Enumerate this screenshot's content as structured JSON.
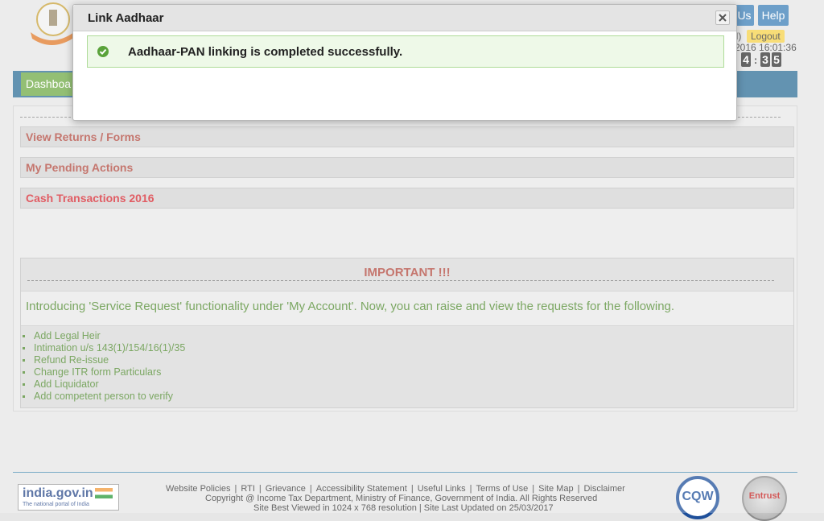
{
  "header": {
    "us_label": "Us",
    "help_label": "Help",
    "user_fragment": "il)",
    "logout_label": "Logout",
    "datetime": "2016 16:01:36",
    "timer_digits": [
      "4",
      "3",
      "5"
    ]
  },
  "nav": {
    "dashboard_label": "Dashboa"
  },
  "accordion": [
    {
      "label": "View Returns / Forms"
    },
    {
      "label": "My Pending Actions"
    },
    {
      "label": "Cash Transactions 2016"
    }
  ],
  "important": {
    "title": "IMPORTANT !!!",
    "intro": "Introducing 'Service Request' functionality under 'My Account'. Now, you can raise and view the requests for the following.",
    "items": [
      "Add Legal Heir",
      "Intimation u/s 143(1)/154/16(1)/35",
      "Refund Re-issue",
      "Change ITR form Particulars",
      "Add Liquidator",
      "Add competent person to verify"
    ]
  },
  "footer": {
    "india_name": "india.gov.in",
    "india_tagline": "The national portal of India",
    "links": [
      "Website Policies",
      "RTI",
      "Grievance",
      "Accessibility Statement",
      "Useful Links",
      "Terms of Use",
      "Site Map",
      "Disclaimer"
    ],
    "copyright": "Copyright @ Income Tax Department, Ministry of Finance, Government of India. All Rights Reserved",
    "best_viewed": "Site Best Viewed in 1024 x 768 resolution | Site Last Updated on 25/03/2017",
    "cqw_label": "CQW",
    "entrust_label": "Entrust"
  },
  "modal": {
    "title": "Link Aadhaar",
    "message": "Aadhaar-PAN linking is completed successfully.",
    "close_icon": "close-icon",
    "status_icon": "check-circle-icon"
  },
  "colors": {
    "nav_bar": "#2f6f97",
    "dashboard_tab": "#6faa46",
    "accent_red": "#b2493e",
    "success_green": "#4f8a2e",
    "help_button": "#3d7fb7",
    "logout_button": "#f6d24a"
  }
}
